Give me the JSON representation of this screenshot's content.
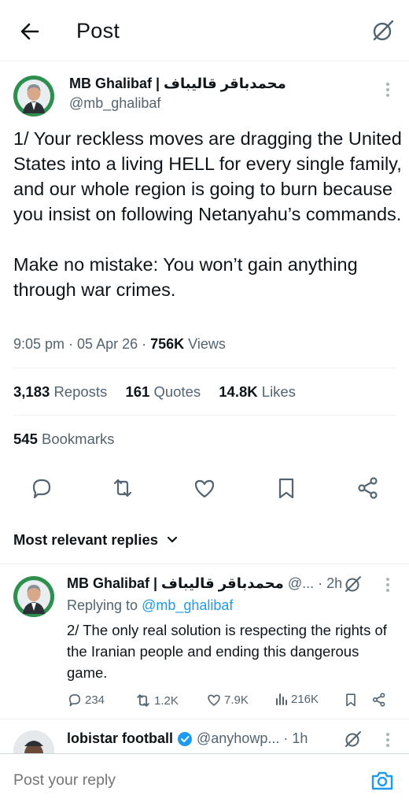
{
  "header": {
    "title": "Post",
    "back_icon": "arrow-left-icon",
    "grok_icon": "grok-icon"
  },
  "tweet": {
    "author_name": "MB Ghalibaf | محمدباقر قالیباف",
    "author_handle": "@mb_ghalibaf",
    "text": "1/ Your reckless moves are dragging the United States into a living HELL for every single family, and our whole region is going to burn because you insist on following Netanyahu’s commands.\n\nMake no mistake: You won’t gain anything through war crimes.",
    "time": "9:05 pm",
    "date": "05 Apr 26",
    "views_count": "756K",
    "views_label": "Views",
    "reposts_count": "3,183",
    "reposts_label": "Reposts",
    "quotes_count": "161",
    "quotes_label": "Quotes",
    "likes_count": "14.8K",
    "likes_label": "Likes",
    "bookmarks_count": "545",
    "bookmarks_label": "Bookmarks"
  },
  "sort": {
    "label": "Most relevant replies"
  },
  "replies": [
    {
      "author_name": "MB Ghalibaf | محمدباقر قالیباف",
      "handle_trunc": "@...",
      "time": "· 2h",
      "replying_prefix": "Replying to",
      "replying_to": "@mb_ghalibaf",
      "text": "2/ The only real solution is respecting the rights of the Iranian people and ending this dangerous game.",
      "reply_count": "234",
      "repost_count": "1.2K",
      "like_count": "7.9K",
      "view_count": "216K"
    },
    {
      "author_name": "lobistar football",
      "handle_trunc": "@anyhowp...",
      "time": "· 1h"
    }
  ],
  "composer": {
    "placeholder": "Post your reply",
    "camera_icon": "camera-icon"
  },
  "colors": {
    "accent": "#1d9bf0",
    "text": "#0f1419",
    "secondary": "#536471",
    "divider": "#eff3f4",
    "avatar_bg": "#2f8f4e"
  }
}
